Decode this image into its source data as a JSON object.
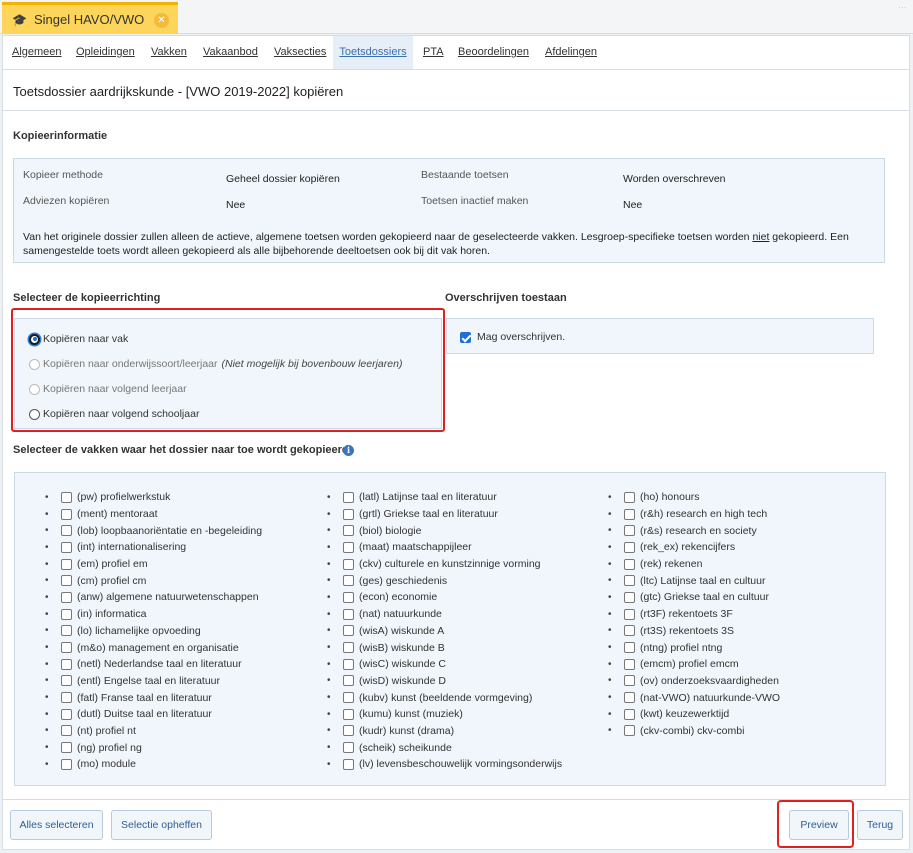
{
  "tab": {
    "title": "Singel HAVO/VWO",
    "corner_text": "…"
  },
  "subnav": [
    {
      "label": "Algemeen",
      "active": false
    },
    {
      "label": "Opleidingen",
      "active": false
    },
    {
      "label": "Vakken",
      "active": false
    },
    {
      "label": "Vakaanbod",
      "active": false
    },
    {
      "label": "Vaksecties",
      "active": false
    },
    {
      "label": "Toetsdossiers",
      "active": true
    },
    {
      "label": "PTA",
      "active": false
    },
    {
      "label": "Beoordelingen",
      "active": false
    },
    {
      "label": "Afdelingen",
      "active": false
    }
  ],
  "page_title": "Toetsdossier aardrijkskunde - [VWO 2019-2022] kopiëren",
  "kopieerinfo": {
    "heading": "Kopieerinformatie",
    "methode_label": "Kopieer methode",
    "methode_value": "Geheel dossier kopiëren",
    "bestaande_label": "Bestaande toetsen",
    "bestaande_value": "Worden overschreven",
    "adviezen_label": "Adviezen kopiëren",
    "adviezen_value": "Nee",
    "inactief_label": "Toetsen inactief maken",
    "inactief_value": "Nee",
    "note_before": "Van het originele dossier zullen alleen de actieve, algemene toetsen worden gekopieerd naar de geselecteerde vakken. Lesgroep-specifieke toetsen worden ",
    "note_underlined": "niet",
    "note_after": " gekopieerd. Een samengestelde toets wordt alleen gekopieerd als alle bijbehorende deeltoetsen ook bij dit vak horen."
  },
  "richting": {
    "heading": "Selecteer de kopieerrichting",
    "options": [
      {
        "label": "Kopiëren naar vak",
        "note": "",
        "checked": true,
        "disabled": false
      },
      {
        "label": "Kopiëren naar onderwijssoort/leerjaar",
        "note": "(Niet mogelijk bij bovenbouw leerjaren)",
        "checked": false,
        "disabled": true
      },
      {
        "label": "Kopiëren naar volgend leerjaar",
        "note": "",
        "checked": false,
        "disabled": true
      },
      {
        "label": "Kopiëren naar volgend schooljaar",
        "note": "",
        "checked": false,
        "disabled": false
      }
    ]
  },
  "overschrijven": {
    "heading": "Overschrijven toestaan",
    "checkbox_label": "Mag overschrijven.",
    "checked": true
  },
  "vakken": {
    "heading": "Selecteer de vakken waar het dossier naar toe wordt gekopieerd",
    "columns": [
      [
        "(pw) profielwerkstuk",
        "(ment) mentoraat",
        "(lob) loopbaanoriëntatie en -begeleiding",
        "(int) internationalisering",
        "(em) profiel em",
        "(cm) profiel cm",
        "(anw) algemene natuurwetenschappen",
        "(in) informatica",
        "(lo) lichamelijke opvoeding",
        "(m&o) management en organisatie",
        "(netl) Nederlandse taal en literatuur",
        "(entl) Engelse taal en literatuur",
        "(fatl) Franse taal en literatuur",
        "(dutl) Duitse taal en literatuur",
        "(nt) profiel nt",
        "(ng) profiel ng",
        "(mo) module"
      ],
      [
        "(latl) Latijnse taal en literatuur",
        "(grtl) Griekse taal en literatuur",
        "(biol) biologie",
        "(maat) maatschappijleer",
        "(ckv) culturele en kunstzinnige vorming",
        "(ges) geschiedenis",
        "(econ) economie",
        "(nat) natuurkunde",
        "(wisA) wiskunde A",
        "(wisB) wiskunde B",
        "(wisC) wiskunde C",
        "(wisD) wiskunde D",
        "(kubv) kunst (beeldende vormgeving)",
        "(kumu) kunst (muziek)",
        "(kudr) kunst (drama)",
        "(scheik) scheikunde",
        "(lv) levensbeschouwelijk vormingsonderwijs"
      ],
      [
        "(ho) honours",
        "(r&h) research en high tech",
        "(r&s) research en society",
        "(rek_ex) rekencijfers",
        "(rek) rekenen",
        "(ltc) Latijnse taal en cultuur",
        "(gtc) Griekse taal en cultuur",
        "(rt3F) rekentoets 3F",
        "(rt3S) rekentoets 3S",
        "(ntng) profiel ntng",
        "(emcm) profiel emcm",
        "(ov) onderzoeksvaardigheden",
        "(nat-VWO) natuurkunde-VWO",
        "(kwt) keuzewerktijd",
        "(ckv-combi) ckv-combi"
      ]
    ]
  },
  "footer": {
    "alles_selecteren": "Alles selecteren",
    "selectie_opheffen": "Selectie opheffen",
    "preview": "Preview",
    "terug": "Terug"
  },
  "colors": {
    "accent": "#fcd55a",
    "highlight": "#e02020",
    "link": "#2d5d99",
    "panel": "#f0f6fb"
  }
}
